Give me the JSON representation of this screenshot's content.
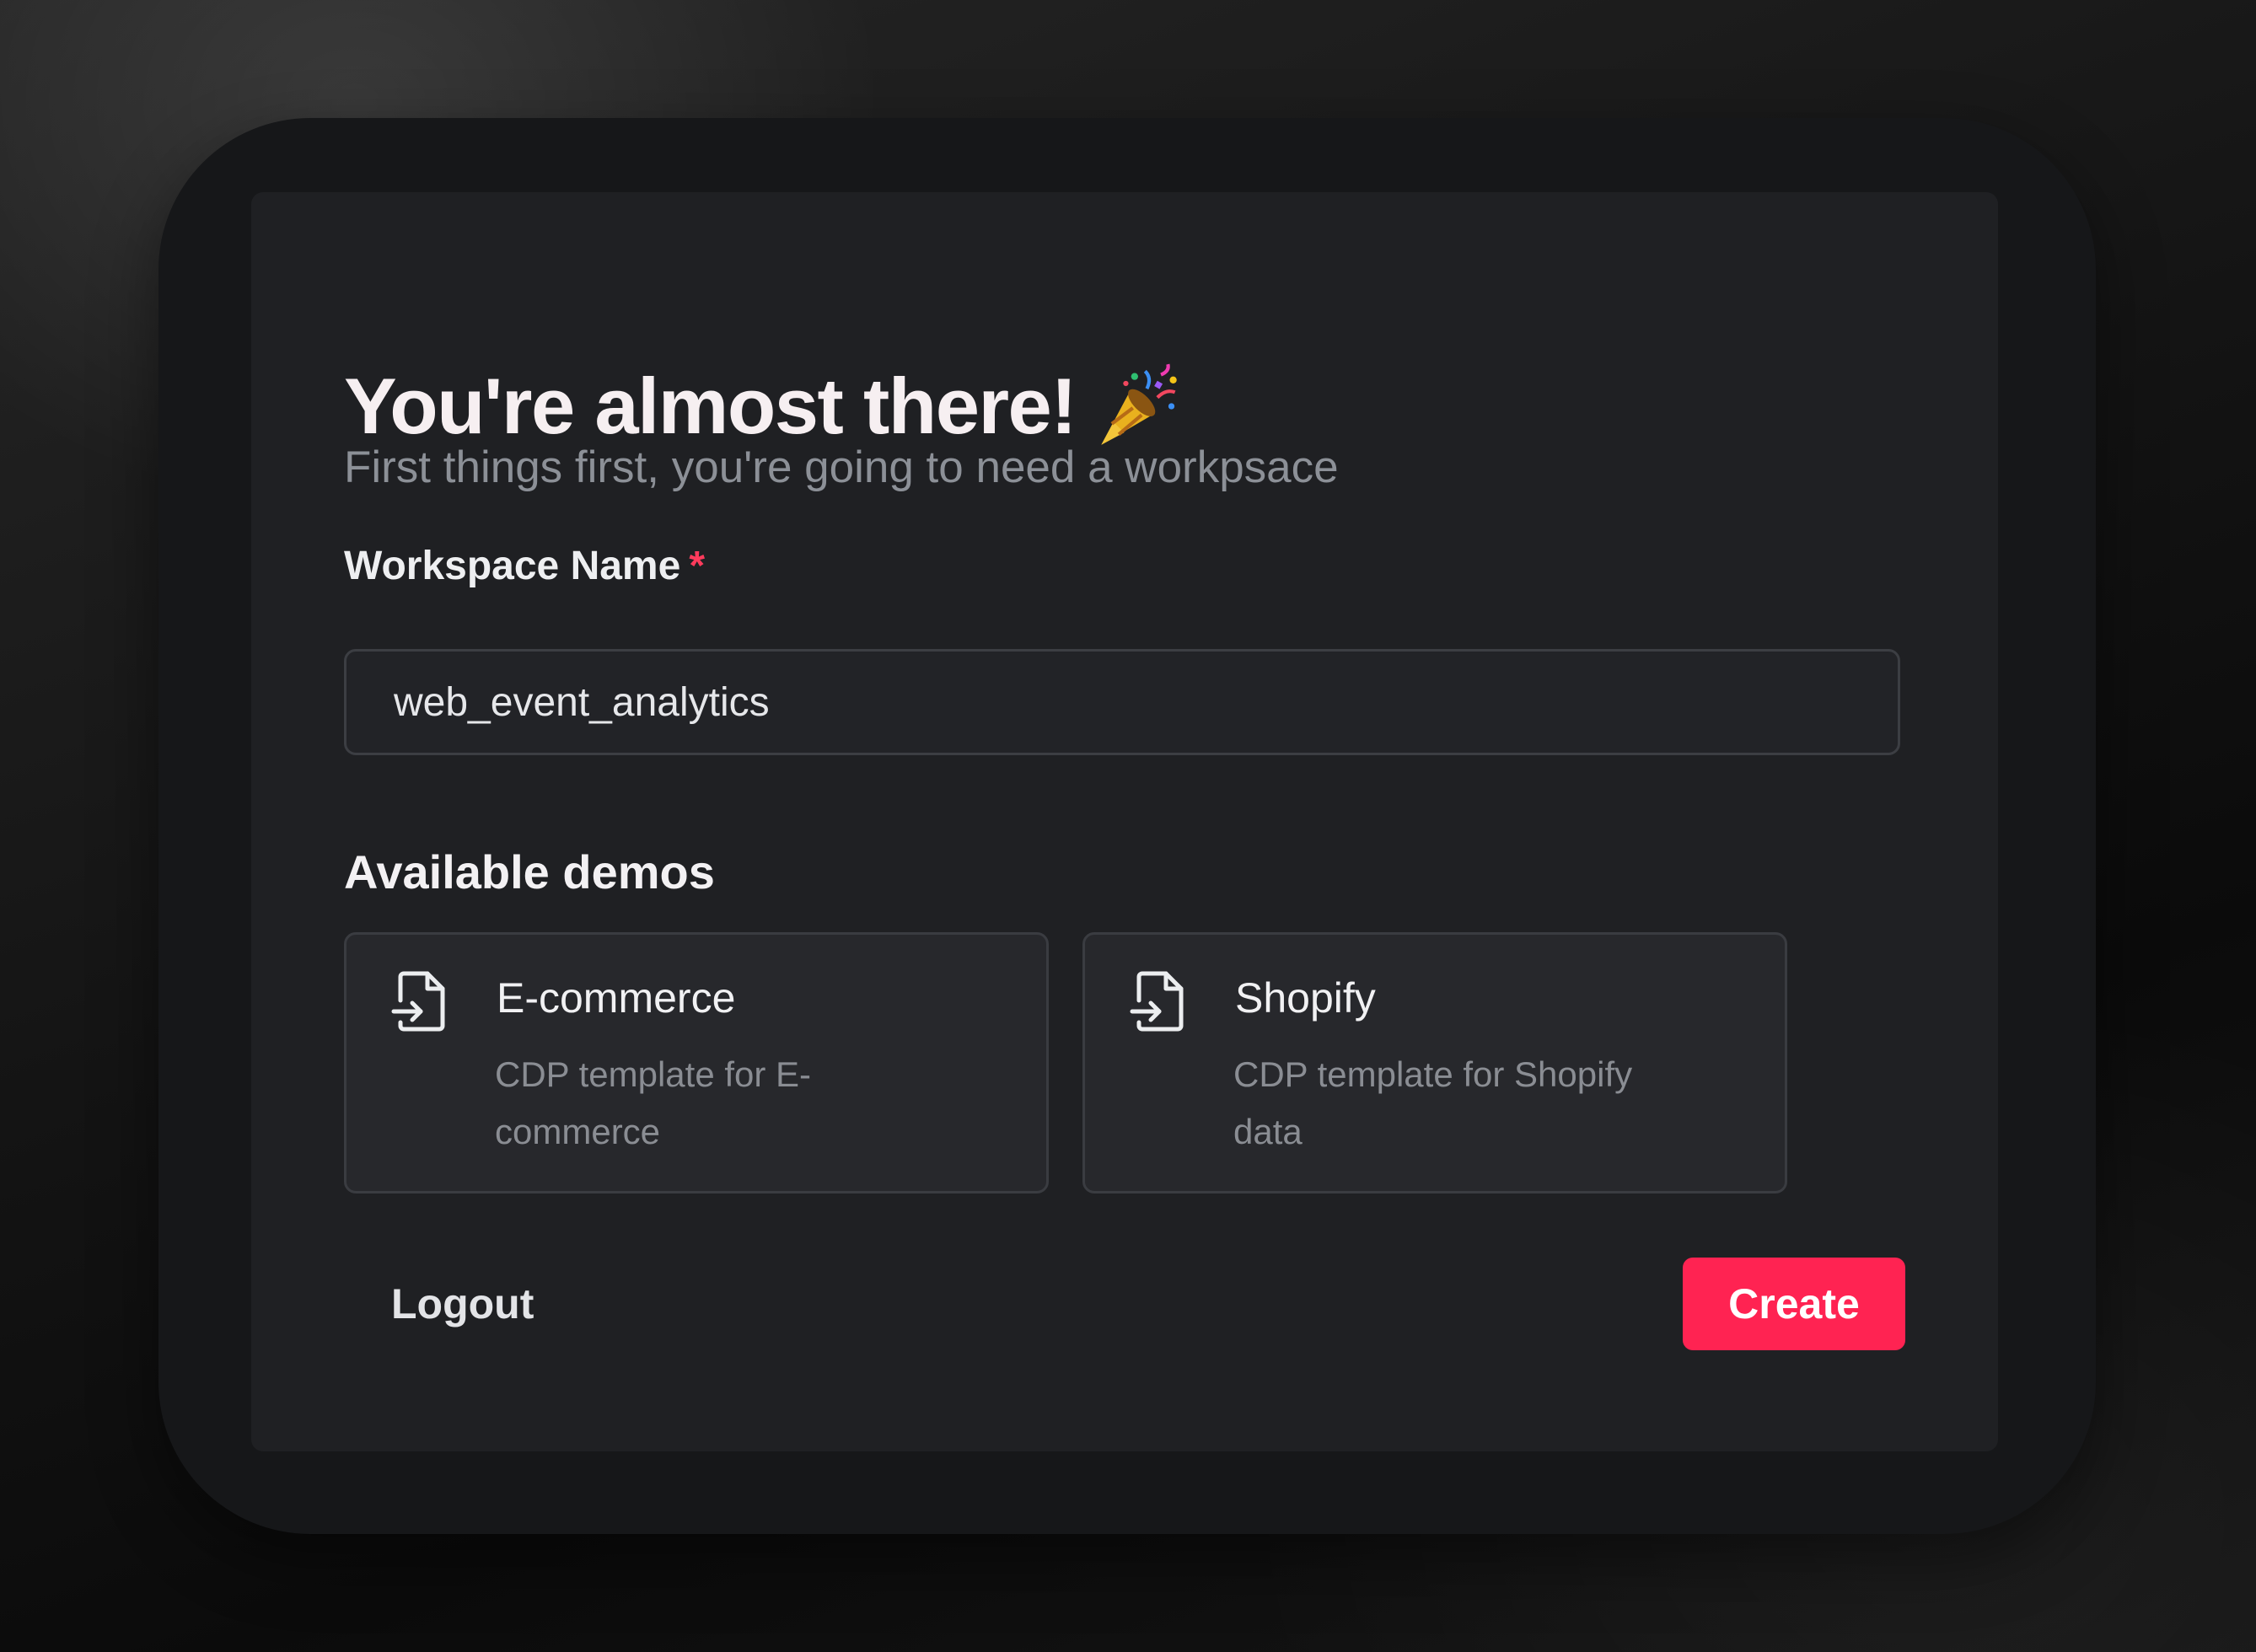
{
  "card": {
    "title": "You're almost there!",
    "title_icon": "party-popper-icon",
    "subtitle": "First things first, you're going to need a workpsace"
  },
  "form": {
    "workspace_label": "Workspace Name",
    "required_marker": "*",
    "workspace_value": "web_event_analytics"
  },
  "demos": {
    "heading": "Available demos",
    "items": [
      {
        "title": "E-commerce",
        "description": "CDP template for E-commerce",
        "icon": "file-import-icon"
      },
      {
        "title": "Shopify",
        "description": "CDP template for Shopify data",
        "icon": "file-import-icon"
      }
    ]
  },
  "actions": {
    "logout_label": "Logout",
    "create_label": "Create"
  },
  "colors": {
    "accent": "#ff2352",
    "background": "#141414",
    "panel": "#1f2023",
    "card": "#27282c",
    "required": "#ff3b5c"
  }
}
